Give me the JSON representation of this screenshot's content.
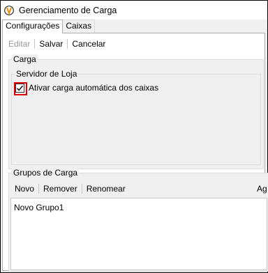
{
  "window": {
    "title": "Gerenciamento de Carga",
    "icon": "app-logo-icon"
  },
  "tabs": [
    {
      "label": "Configurações",
      "active": true
    },
    {
      "label": "Caixas",
      "active": false
    }
  ],
  "toolbar": {
    "edit_label": "Editar",
    "save_label": "Salvar",
    "cancel_label": "Cancelar"
  },
  "carga": {
    "title": "Carga",
    "servidor": {
      "title": "Servidor de Loja",
      "checkbox_label": "Ativar carga automática dos caixas",
      "checked": true
    }
  },
  "grupos": {
    "title": "Grupos de Carga",
    "toolbar": {
      "new_label": "Novo",
      "remove_label": "Remover",
      "rename_label": "Renomear",
      "right_label": "Ag"
    },
    "items": [
      "Novo Grupo1"
    ]
  },
  "colors": {
    "highlight": "#e00000",
    "panel_bg": "#f0f0f0",
    "disabled_text": "#9a9a9a"
  }
}
